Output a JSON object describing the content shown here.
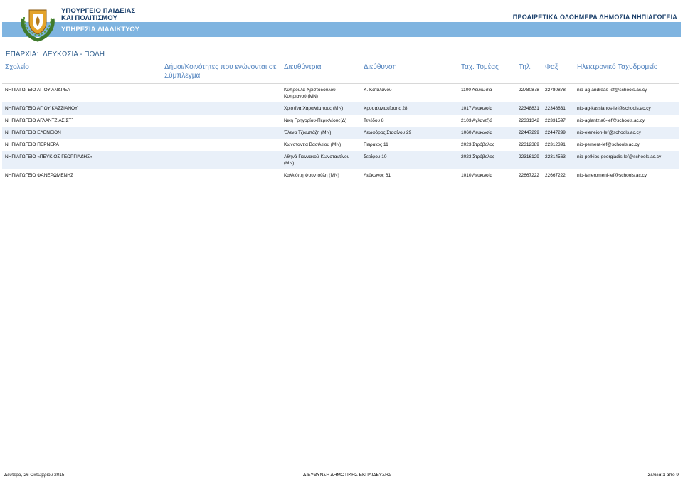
{
  "header": {
    "ministry_line1": "ΥΠΟΥΡΓΕΙΟ ΠΑΙΔΕΙΑΣ",
    "ministry_line2": "ΚΑΙ ΠΟΛΙΤΙΣΜΟΥ",
    "service": "ΥΠΗΡΕΣΙΑ ΔΙΑΔΙΚΤΥΟΥ",
    "program": "ΠΡΟΑΙΡΕΤΙΚΑ ΟΛΟΗΜΕΡΑ ΔΗΜΟΣΙΑ ΝΗΠΙΑΓΩΓΕΙΑ",
    "banner_color": "#7fb4e0"
  },
  "region": {
    "label": "ΕΠΑΡΧΙΑ:",
    "value": "ΛΕΥΚΩΣΙΑ - ΠΟΛΗ"
  },
  "table": {
    "columns": [
      "Σχολείο",
      "Δήμοι/Κοινότητες που ενώνονται σε Σύμπλεγμα",
      "Διευθύντρια",
      "Διεύθυνση",
      "Ταχ. Τομέας",
      "Τηλ.",
      "Φαξ",
      "Ηλεκτρονικό Ταχυδρομείο"
    ],
    "rows": [
      [
        "ΝΗΠΙΑΓΩΓΕΙΟ ΑΓΙΟΥ ΑΝΔΡΕΑ",
        "",
        "Κυπρούλα Χριστοδούλου-Κυπριανού (ΜΝ)",
        "Κ. Καταλάνου",
        "1100 Λευκωσία",
        "22780878",
        "22780878",
        "nip-ag-andreas-lef@schools.ac.cy"
      ],
      [
        "ΝΗΠΙΑΓΩΓΕΙΟ ΑΓΙΟΥ ΚΑΣΣΙΑΝΟΥ",
        "",
        "Χριστίνα Χαραλάμπους (ΜΝ)",
        "Χρυσαλινιωτίσσης 28",
        "1017 Λευκωσία",
        "22348831",
        "22348831",
        "nip-ag-kassianos-lef@schools.ac.cy"
      ],
      [
        "ΝΗΠΙΑΓΩΓΕΙΟ ΑΓΛΑΝΤΖΙΑΣ ΣΤ΄",
        "",
        "Νικη Γρηγορίου-Περικλέους(Δ)",
        "Τενέδου 8",
        "2103 Αγλαντζιά",
        "22331342",
        "22331597",
        "nip-aglantzia6-lef@schools.ac.cy"
      ],
      [
        "ΝΗΠΙΑΓΩΓΕΙΟ ΕΛΕΝΕΙΟΝ",
        "",
        "Έλενα Τζιαμπάζη (ΜΝ)",
        "Λεωφόρος Στασίνου 29",
        "1060 Λευκωσία",
        "22447299",
        "22447299",
        "nip-eleneion-lef@schools.ac.cy"
      ],
      [
        "ΝΗΠΙΑΓΩΓΕΙΟ ΠΕΡΝΕΡΑ",
        "",
        "Κωνσταντία Βασιλείου (ΜΝ)",
        "Πειραιώς 11",
        "2023 Στρόβολος",
        "22312389",
        "22312391",
        "nip-pernera-lef@schools.ac.cy"
      ],
      [
        "ΝΗΠΙΑΓΩΓΕΙΟ «ΠΕΥΚΙΟΣ ΓΕΩΡΓΙΑΔΗΣ»",
        "",
        "Αθηνά Γιαννακού-Κωνσταντίνου (ΜΝ)",
        "Σερίφου 10",
        "2023 Στρόβολος",
        "22316129",
        "22314563",
        "nip-pefkios-georgiadis-lef@schools.ac.cy"
      ],
      [
        "ΝΗΠΙΑΓΩΓΕΙΟ ΦΑΝΕΡΩΜΕΝΗΣ",
        "",
        "Καλλιόπη Φουντούλη (ΜΝ)",
        "Λεύκωνος 61",
        "1010 Λευκωσία",
        "22667222",
        "22667222",
        "nip-faneromeni-lef@schools.ac.cy"
      ]
    ]
  },
  "footer": {
    "date": "Δευτέρα, 26 Οκτωβρίου 2015",
    "department": "ΔΙΕΥΘΥΝΣΗ ΔΗΜΟΤΙΚΗΣ ΕΚΠΑΙΔΕΥΣΗΣ",
    "page": "Σελίδα 1 από 9"
  }
}
